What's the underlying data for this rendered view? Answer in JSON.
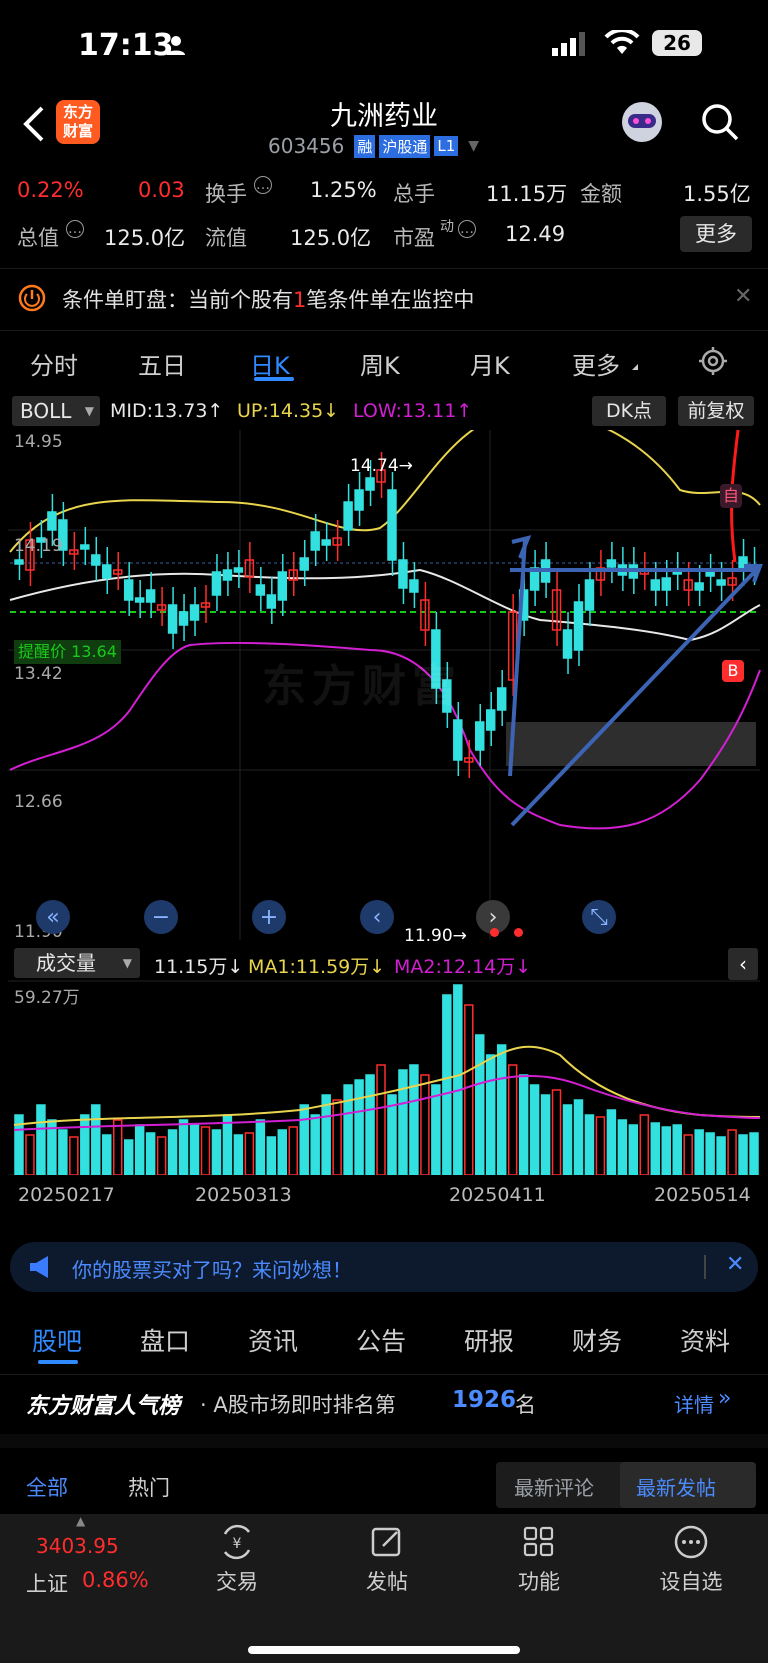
{
  "status_bar": {
    "time": "17:13",
    "battery": "26"
  },
  "header": {
    "brand_line1": "东方",
    "brand_line2": "财富",
    "title": "九洲药业",
    "code": "603456",
    "tag_rong": "融",
    "tag_hsgt": "沪股通",
    "tag_level": "L1"
  },
  "quote": {
    "change_pct": "0.22%",
    "change_amt": "0.03",
    "turnover_label": "换手",
    "turnover_value": "1.25%",
    "volume_label": "总手",
    "volume_value": "11.15万",
    "amount_label": "金额",
    "amount_value": "1.55亿",
    "mktcap_label": "总值",
    "mktcap_value": "125.0亿",
    "float_label": "流值",
    "float_value": "125.0亿",
    "pe_label": "市盈",
    "pe_sup": "动",
    "pe_value": "12.49",
    "more_button": "更多"
  },
  "alert": {
    "prefix": "条件单盯盘：当前个股有",
    "count": "1",
    "suffix": "笔条件单在监控中"
  },
  "chart_tabs": [
    "分时",
    "五日",
    "日K",
    "周K",
    "月K",
    "更多"
  ],
  "indicator": {
    "name": "BOLL",
    "mid": "MID:13.73↑",
    "up": "UP:14.35↓",
    "low": "LOW:13.11↑",
    "dk_button": "DK点",
    "adjust_button": "前复权",
    "colors": {
      "up": "#e8d44d",
      "low": "#d21fd2",
      "mid": "#e8e8e8",
      "bull": "#33e0e0",
      "bear": "#ff2d2d"
    }
  },
  "price_axis": {
    "p1": "14.95",
    "p2": "14.19",
    "p3": "13.42",
    "p4": "12.66",
    "p5": "11.90"
  },
  "chart_labels": {
    "high_marker": "14.74→",
    "low_marker": "11.90→",
    "reminder_price": "提醒价 13.64",
    "badge_b": "B",
    "badge_zi": "自",
    "watermark": "东方财富"
  },
  "volume": {
    "name": "成交量",
    "value": "11.15万↓",
    "ma1": "MA1:11.59万↓",
    "ma2": "MA2:12.14万↓",
    "axis_max": "59.27万",
    "dates": [
      "20250217",
      "20250313",
      "20250411",
      "20250514"
    ]
  },
  "promo": {
    "text": "你的股票买对了吗？来问妙想！"
  },
  "bottom_tabs": [
    "股吧",
    "盘口",
    "资讯",
    "公告",
    "研报",
    "财务",
    "资料"
  ],
  "ranking": {
    "brand": "东方财富人气榜",
    "text_prefix": "· A股市场即时排名第",
    "rank": "1926",
    "text_suffix": "名",
    "detail": "详情"
  },
  "post_filters": {
    "all": "全部",
    "hot": "热门",
    "latest_comment": "最新评论",
    "latest_post": "最新发帖"
  },
  "bottom_nav": {
    "index_value": "3403.95",
    "index_name": "上证",
    "index_change": "0.86%",
    "items": [
      {
        "label": "交易",
        "icon": "yuan-exchange-icon"
      },
      {
        "label": "发帖",
        "icon": "edit-icon"
      },
      {
        "label": "功能",
        "icon": "grid-icon"
      },
      {
        "label": "设自选",
        "icon": "more-dots-icon"
      }
    ]
  }
}
